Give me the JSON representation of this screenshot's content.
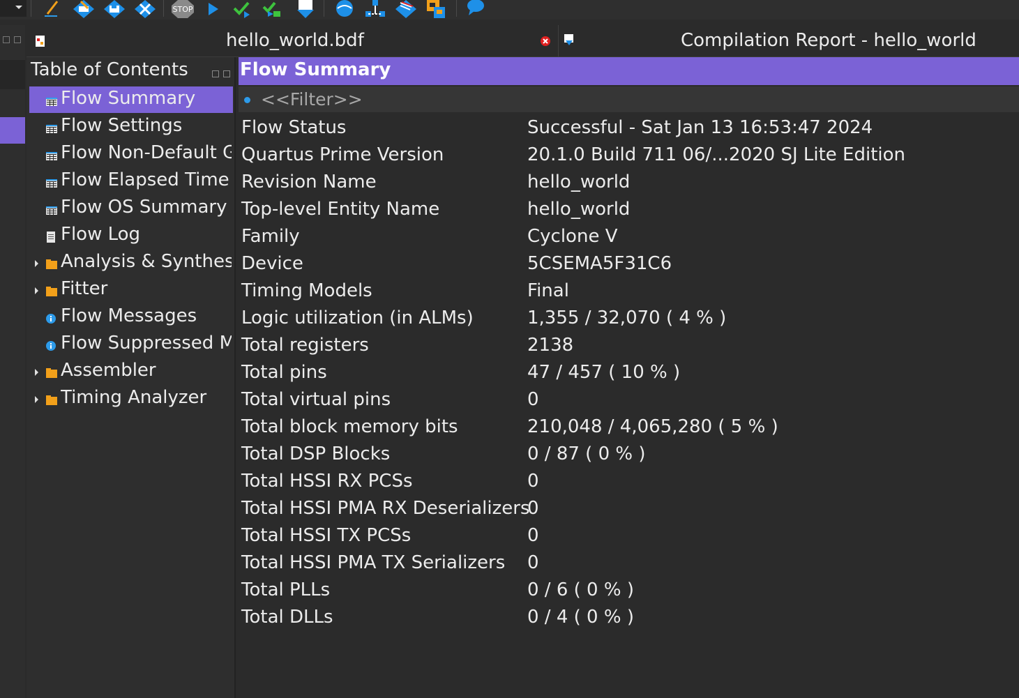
{
  "toolbar": {
    "icons": [
      "pencil-icon",
      "edit-diamond-icon",
      "save-diamond-icon",
      "settings-diamond-icon",
      "stop-icon",
      "play-icon",
      "check-icon",
      "check-step-icon",
      "export-icon",
      "globe-icon",
      "network-icon",
      "flag-diamond-icon",
      "windows-icon",
      "chat-icon"
    ],
    "stop_label": "STOP"
  },
  "tabs": [
    {
      "label": "hello_world.bdf",
      "icon": "bdf-file-icon",
      "close_icon": "close-icon"
    },
    {
      "label": "Compilation Report - hello_world",
      "icon": "report-icon"
    }
  ],
  "toc": {
    "title": "Table of Contents",
    "items": [
      {
        "label": "Flow Summary",
        "icon": "table-icon",
        "expandable": false
      },
      {
        "label": "Flow Settings",
        "icon": "table-icon",
        "expandable": false
      },
      {
        "label": "Flow Non-Default Global Settings",
        "icon": "table-icon",
        "expandable": false
      },
      {
        "label": "Flow Elapsed Time",
        "icon": "table-icon",
        "expandable": false
      },
      {
        "label": "Flow OS Summary",
        "icon": "table-icon",
        "expandable": false
      },
      {
        "label": "Flow Log",
        "icon": "document-icon",
        "expandable": false
      },
      {
        "label": "Analysis & Synthesis",
        "icon": "folder-icon",
        "expandable": true
      },
      {
        "label": "Fitter",
        "icon": "folder-icon",
        "expandable": true
      },
      {
        "label": "Flow Messages",
        "icon": "info-icon",
        "expandable": false
      },
      {
        "label": "Flow Suppressed Messages",
        "icon": "info-icon",
        "expandable": false
      },
      {
        "label": "Assembler",
        "icon": "folder-icon",
        "expandable": true
      },
      {
        "label": "Timing Analyzer",
        "icon": "folder-icon",
        "expandable": true
      }
    ]
  },
  "report": {
    "title": "Flow Summary",
    "filter_placeholder": "<<Filter>>",
    "rows": [
      {
        "key": "Flow Status",
        "value": "Successful - Sat Jan 13 16:53:47 2024"
      },
      {
        "key": "Quartus Prime Version",
        "value": "20.1.0 Build 711 06/...2020 SJ Lite Edition"
      },
      {
        "key": "Revision Name",
        "value": "hello_world"
      },
      {
        "key": "Top-level Entity Name",
        "value": "hello_world"
      },
      {
        "key": "Family",
        "value": "Cyclone V"
      },
      {
        "key": "Device",
        "value": "5CSEMA5F31C6"
      },
      {
        "key": "Timing Models",
        "value": "Final"
      },
      {
        "key": "Logic utilization (in ALMs)",
        "value": "1,355 / 32,070 ( 4 % )"
      },
      {
        "key": "Total registers",
        "value": "2138"
      },
      {
        "key": "Total pins",
        "value": "47 / 457 ( 10 % )"
      },
      {
        "key": "Total virtual pins",
        "value": "0"
      },
      {
        "key": "Total block memory bits",
        "value": "210,048 / 4,065,280 ( 5 % )"
      },
      {
        "key": "Total DSP Blocks",
        "value": "0 / 87 ( 0 % )"
      },
      {
        "key": "Total HSSI RX PCSs",
        "value": "0"
      },
      {
        "key": "Total HSSI PMA RX Deserializers",
        "value": "0"
      },
      {
        "key": "Total HSSI TX PCSs",
        "value": "0"
      },
      {
        "key": "Total HSSI PMA TX Serializers",
        "value": "0"
      },
      {
        "key": "Total PLLs",
        "value": "0 / 6 ( 0 % )"
      },
      {
        "key": "Total DLLs",
        "value": "0 / 4 ( 0 % )"
      }
    ]
  },
  "colors": {
    "accent": "#7b62d6",
    "background": "#2b2b2b",
    "folder": "#f2a01a",
    "info": "#2d9bea",
    "close": "#e02020"
  }
}
